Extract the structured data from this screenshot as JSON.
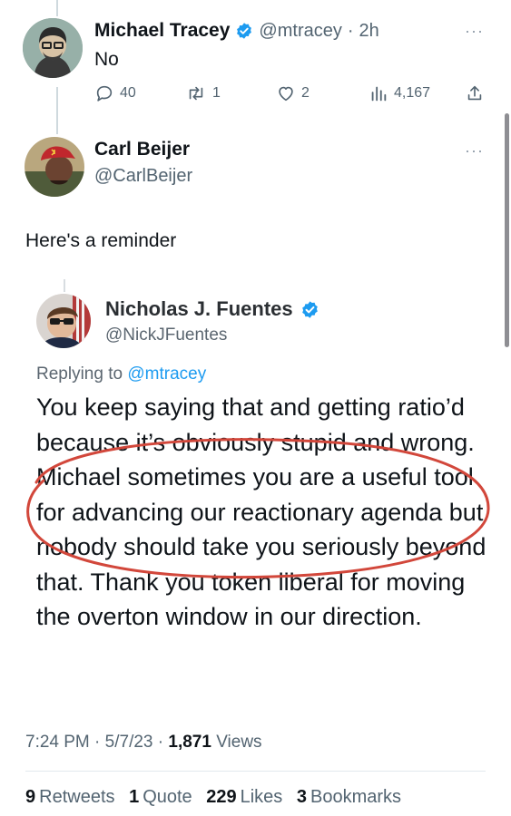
{
  "tweet1": {
    "name": "Michael Tracey",
    "handle": "@mtracey",
    "time": "2h",
    "text": "No",
    "replies": "40",
    "retweets": "1",
    "likes": "2",
    "views": "4,167"
  },
  "tweet2": {
    "name": "Carl Beijer",
    "handle": "@CarlBeijer",
    "text": "Here's a reminder"
  },
  "quoted": {
    "name": "Nicholas J. Fuentes",
    "handle": "@NickJFuentes",
    "replying_prefix": "Replying to",
    "replying_to": "@mtracey",
    "body": "You keep saying that and getting ratio’d because it’s obviously stupid and wrong. Michael sometimes you are a useful tool for advancing our reactionary agenda but nobody should take you seriously beyond that. Thank you token liberal for moving the overton window in our direction."
  },
  "meta": {
    "time": "7:24 PM",
    "date": "5/7/23",
    "views_count": "1,871",
    "views_label": "Views"
  },
  "stats": {
    "retweets_count": "9",
    "retweets_label": "Retweets",
    "quotes_count": "1",
    "quotes_label": "Quote",
    "likes_count": "229",
    "likes_label": "Likes",
    "bookmarks_count": "3",
    "bookmarks_label": "Bookmarks"
  },
  "colors": {
    "verified": "#1d9bf0",
    "link": "#1d9bf0",
    "secondary": "#536471",
    "annotation": "#d2473b"
  },
  "icons": [
    "reply-icon",
    "retweet-icon",
    "like-icon",
    "views-icon",
    "share-icon",
    "verified-icon",
    "more-icon"
  ]
}
